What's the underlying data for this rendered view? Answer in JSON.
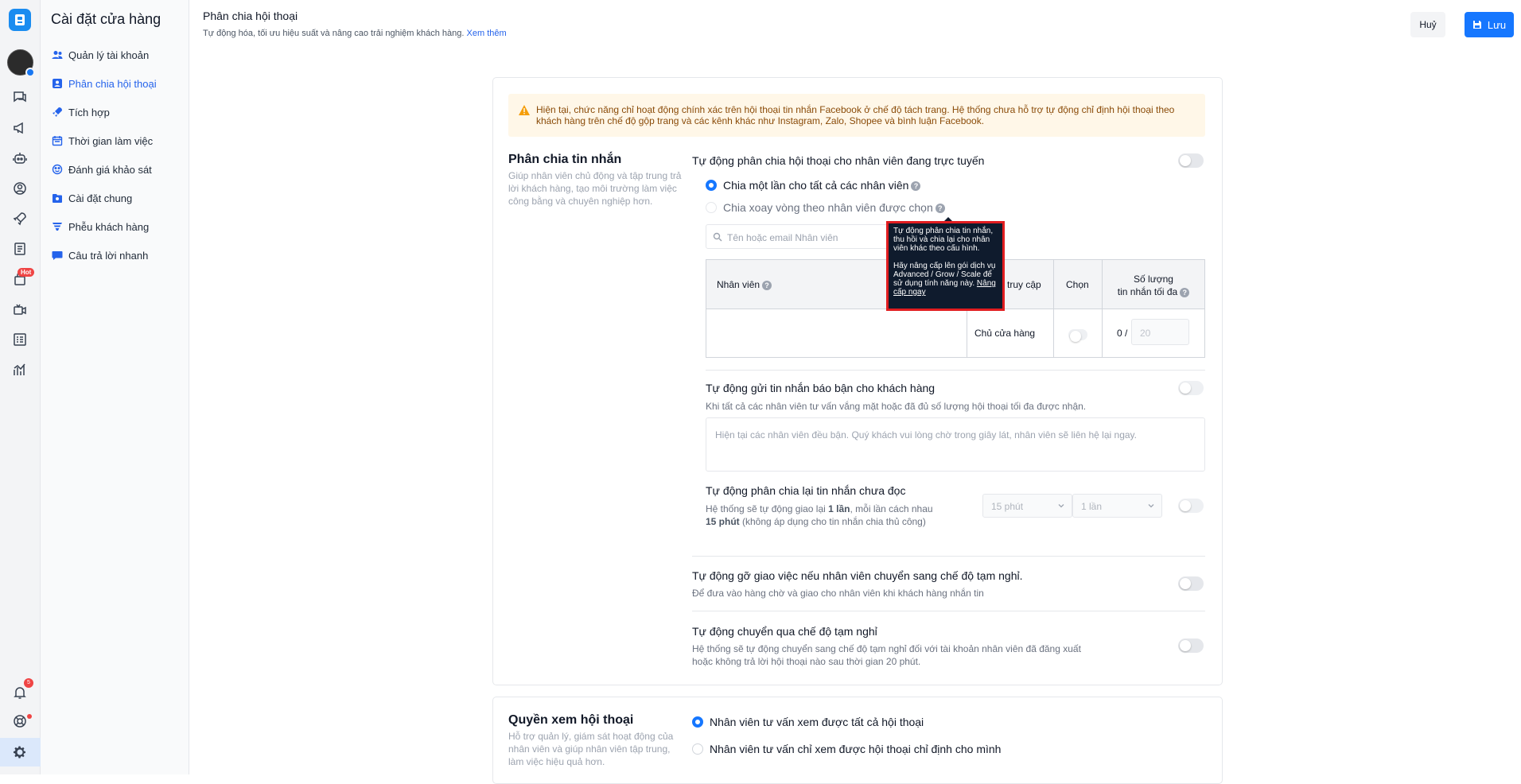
{
  "rail": {
    "hot_badge": "Hot",
    "notif_count": "5"
  },
  "sidebar": {
    "title": "Cài đặt cửa hàng",
    "items": [
      {
        "label": "Quản lý tài khoản",
        "icon": "users-icon"
      },
      {
        "label": "Phân chia hội thoại",
        "icon": "assign-icon"
      },
      {
        "label": "Tích hợp",
        "icon": "rocket-icon"
      },
      {
        "label": "Thời gian làm việc",
        "icon": "calendar-icon"
      },
      {
        "label": "Đánh giá khảo sát",
        "icon": "survey-icon"
      },
      {
        "label": "Cài đặt chung",
        "icon": "settings-icon"
      },
      {
        "label": "Phễu khách hàng",
        "icon": "funnel-icon"
      },
      {
        "label": "Câu trả lời nhanh",
        "icon": "chat-icon"
      }
    ]
  },
  "header": {
    "title": "Phân chia hội thoại",
    "subtitle": "Tự động hóa, tối ưu hiệu suất và nâng cao trải nghiệm khách hàng.",
    "more_link": "Xem thêm",
    "cancel": "Huỷ",
    "save": "Lưu"
  },
  "warning": "Hiện tại, chức năng chỉ hoạt động chính xác trên hội thoại tin nhắn Facebook ở chế độ tách trang. Hệ thống chưa hỗ trợ tự động chỉ định hội thoại theo khách hàng trên chế độ gộp trang và các kênh khác như Instagram, Zalo, Shopee và bình luận Facebook.",
  "split": {
    "title": "Phân chia tin nhắn",
    "desc": "Giúp nhân viên chủ động và tập trung trả lời khách hàng, tạo môi trường làm việc công bằng và chuyên nghiệp hơn.",
    "auto_online": "Tự động phân chia hội thoại cho nhân viên đang trực tuyến",
    "opt_once": "Chia một lần cho tất cả các nhân viên",
    "opt_rotate": "Chia xoay vòng theo nhân viên được chọn",
    "search_placeholder": "Tên hoặc email Nhân viên",
    "tooltip_p1": "Tự động phân chia tin nhắn, thu hồi và chia lại cho nhân viên khác theo cấu hình.",
    "tooltip_p2": "Hãy nâng cấp lên gói dịch vụ Advanced / Grow / Scale để sử dụng tính năng này.",
    "tooltip_link": "Nâng cấp ngay",
    "table": {
      "col_staff": "Nhân viên",
      "col_access": "truy cập",
      "col_select": "Chọn",
      "col_max_1": "Số lượng",
      "col_max_2": "tin nhắn tối đa",
      "row_role": "Chủ cửa hàng",
      "row_count": "0 /",
      "row_max": "20"
    },
    "busy_title": "Tự động gửi tin nhắn báo bận cho khách hàng",
    "busy_desc": "Khi tất cả các nhân viên tư vấn vắng mặt hoặc đã đủ số lượng hội thoại tối đa được nhận.",
    "busy_placeholder": "Hiện tại các nhân viên đều bận. Quý khách vui lòng chờ trong giây lát, nhân viên sẽ liên hệ lại ngay.",
    "reassign_title": "Tự động phân chia lại tin nhắn chưa đọc",
    "reassign_desc_a": "Hệ thống sẽ tự động giao lại ",
    "reassign_times": "1 lần",
    "reassign_desc_b": ", mỗi lần cách nhau",
    "reassign_minutes": "15 phút",
    "reassign_desc_c": " (không áp dụng cho tin nhắn chia thủ công)",
    "sel_minutes": "15 phút",
    "sel_times": "1 lần",
    "unassign_title": "Tự động gỡ giao việc nếu nhân viên chuyển sang chế độ tạm nghỉ.",
    "unassign_desc": "Để đưa vào hàng chờ và giao cho nhân viên khi khách hàng nhắn tin",
    "away_title": "Tự động chuyển qua chế độ tạm nghỉ",
    "away_desc_1": "Hệ thống sẽ tự động chuyển sang chế độ tạm nghỉ đối với tài khoản nhân viên đã đăng xuất",
    "away_desc_2": "hoặc không trả lời hội thoại nào sau thời gian 20 phút."
  },
  "view": {
    "title": "Quyền xem hội thoại",
    "desc": "Hỗ trợ quản lý, giám sát hoạt động của nhân viên và giúp nhân viên tập trung, làm việc hiệu quả hơn.",
    "opt_all": "Nhân viên tư vấn xem được tất cả hội thoại",
    "opt_own": "Nhân viên tư vấn chỉ xem được hội thoại chỉ định cho mình"
  }
}
